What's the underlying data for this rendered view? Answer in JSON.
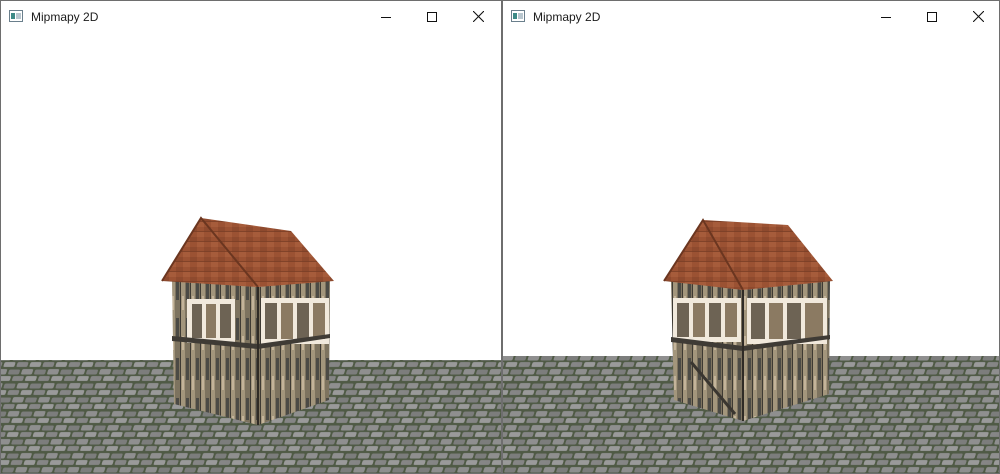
{
  "windows": [
    {
      "title": "Mipmapy 2D",
      "icon": "app-window-icon",
      "controls": [
        "minimize-icon",
        "maximize-icon",
        "close-icon"
      ]
    },
    {
      "title": "Mipmapy 2D",
      "icon": "app-window-icon",
      "controls": [
        "minimize-icon",
        "maximize-icon",
        "close-icon"
      ]
    }
  ],
  "scene": {
    "sky_color": "#ffffff",
    "ground_color": "#6f6f6f",
    "roof_color": "#9c5233",
    "wall_color": "#8c7c66"
  }
}
